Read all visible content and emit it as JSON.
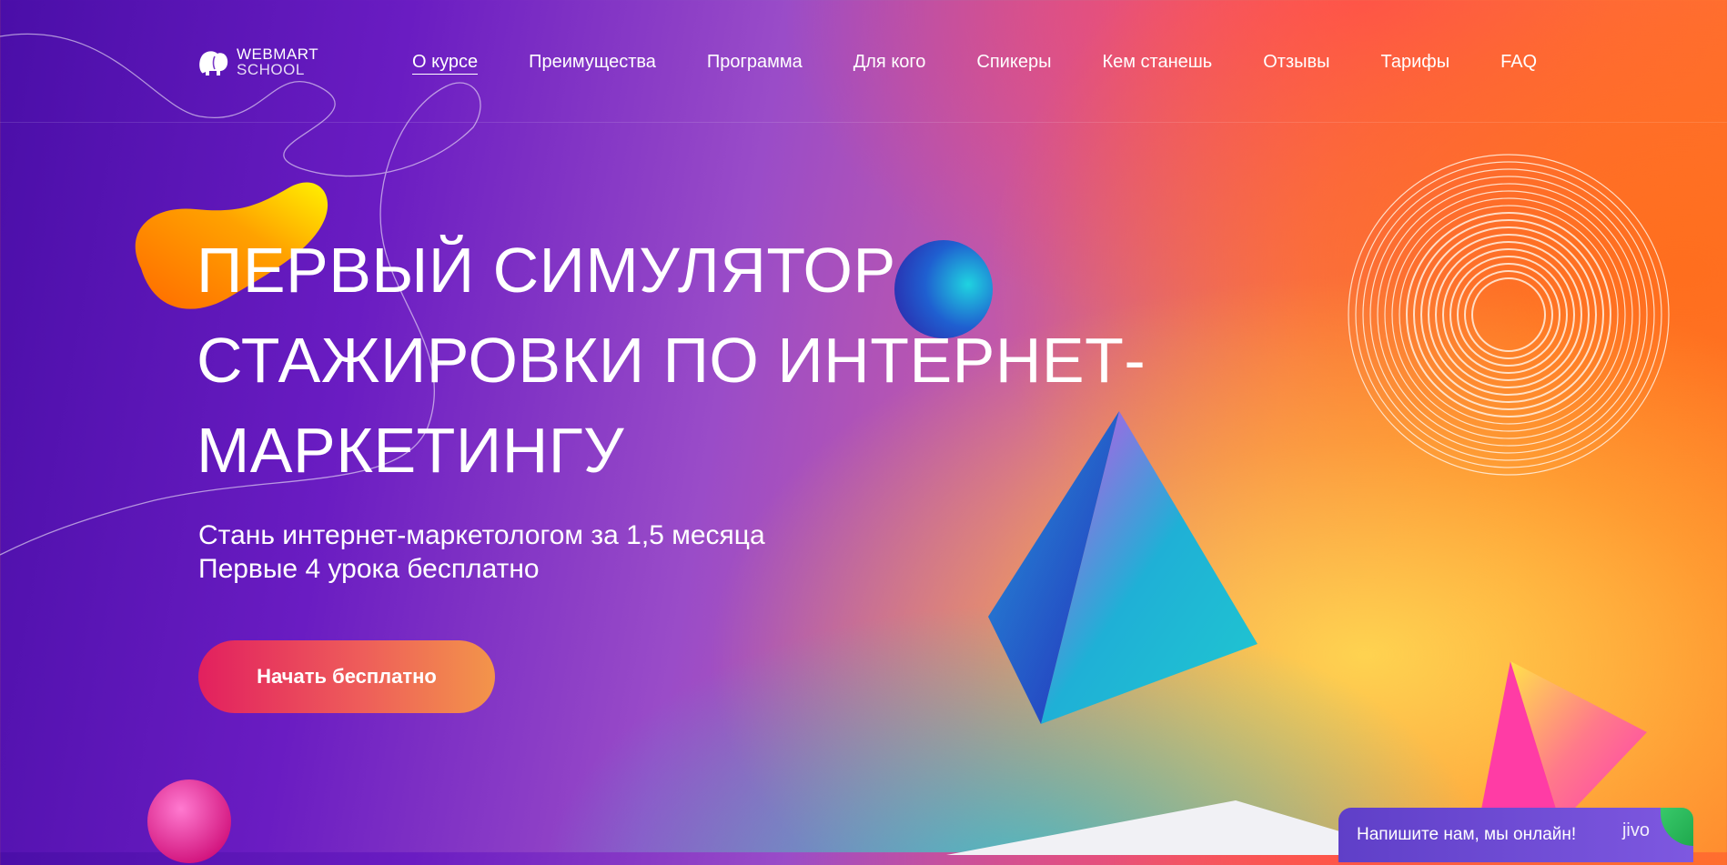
{
  "logo": {
    "line1": "WEBMART",
    "line2": "SCHOOL"
  },
  "nav": [
    {
      "label": "О курсе",
      "active": true
    },
    {
      "label": "Преимущества"
    },
    {
      "label": "Программа"
    },
    {
      "label": "Для кого"
    },
    {
      "label": "Спикеры"
    },
    {
      "label": "Кем станешь"
    },
    {
      "label": "Отзывы"
    },
    {
      "label": "Тарифы"
    },
    {
      "label": "FAQ"
    }
  ],
  "hero": {
    "title_lines": [
      "Первый симулятор",
      "стажировки по интернет-",
      "маркетингу"
    ],
    "subtitle_lines": [
      "Стань интернет-маркетологом за 1,5 месяца",
      "Первые 4 урока бесплатно"
    ],
    "cta": "Начать бесплатно"
  },
  "chat": {
    "text": "Напишите нам, мы онлайн!",
    "brand": "jivo"
  },
  "colors": {
    "cta_start": "#e2205f",
    "cta_end": "#f3954a",
    "chat_bg": "#6a48d4"
  }
}
